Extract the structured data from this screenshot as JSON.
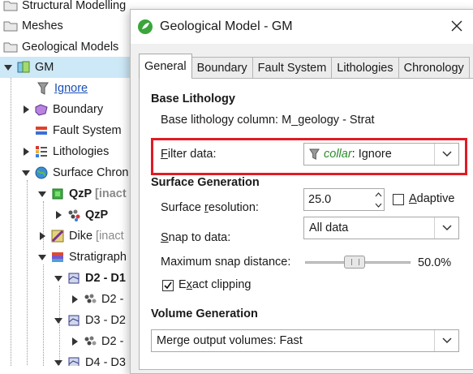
{
  "tree": {
    "items": [
      {
        "label": "Structural Modelling"
      },
      {
        "label": "Meshes"
      },
      {
        "label": "Geological Models"
      },
      {
        "label": "GM"
      },
      {
        "label": "Ignore"
      },
      {
        "label": "Boundary"
      },
      {
        "label": "Fault System"
      },
      {
        "label": "Lithologies"
      },
      {
        "label": "Surface Chron"
      },
      {
        "label": "QzP",
        "suffix": "[inact"
      },
      {
        "label": "QzP"
      },
      {
        "label": "Dike",
        "suffix": "[inact"
      },
      {
        "label": "Stratigraph"
      },
      {
        "label": "D2 - D1"
      },
      {
        "label": "D2 -"
      },
      {
        "label": "D3 - D2"
      },
      {
        "label": "D2 -"
      },
      {
        "label": "D4 - D3"
      }
    ]
  },
  "dialog": {
    "title": "Geological Model - GM",
    "tabs": [
      "General",
      "Boundary",
      "Fault System",
      "Lithologies",
      "Chronology"
    ],
    "base_lithology": {
      "heading": "Base Lithology",
      "column_text": "Base lithology column:  M_geology - Strat",
      "filter_label_u": "F",
      "filter_label_rest": "ilter data:",
      "filter_value_prefix": "collar",
      "filter_value_suffix": ": Ignore"
    },
    "surface_generation": {
      "heading": "Surface Generation",
      "resolution_label_pre": "Surface ",
      "resolution_label_u": "r",
      "resolution_label_post": "esolution:",
      "resolution_value": "25.0",
      "adaptive_label_u": "A",
      "adaptive_label_rest": "daptive",
      "adaptive_checked": false,
      "snap_label_u": "S",
      "snap_label_rest": "nap to data:",
      "snap_value": "All data",
      "max_snap_label": "Maximum snap distance:",
      "max_snap_value": "50.0%",
      "max_snap_fraction": 0.5,
      "exact_label_pre": "E",
      "exact_label_u": "x",
      "exact_label_post": "act clipping",
      "exact_checked": true
    },
    "volume_generation": {
      "heading": "Volume Generation",
      "merge_value": "Merge output volumes: Fast"
    }
  },
  "colors": {
    "selection": "#cde8f7",
    "highlight": "#e01b24",
    "link": "#1a4fb8",
    "filter_green": "#2e8b2e"
  }
}
